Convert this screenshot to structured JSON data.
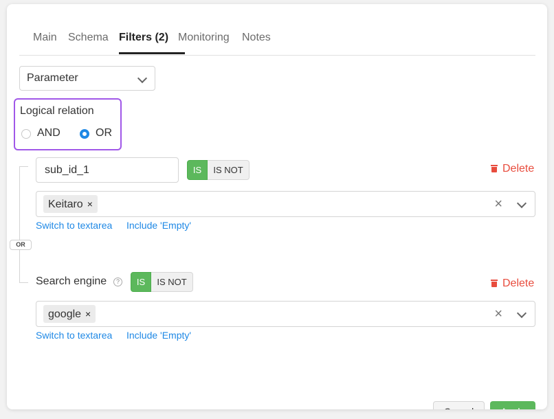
{
  "tabs": [
    {
      "label": "Main"
    },
    {
      "label": "Schema"
    },
    {
      "label": "Filters (2)"
    },
    {
      "label": "Monitoring"
    },
    {
      "label": "Notes"
    }
  ],
  "parameter_select": {
    "value": "Parameter",
    "icon": "chevron-down-icon"
  },
  "logical_relation": {
    "title": "Logical relation",
    "options": [
      {
        "label": "AND",
        "checked": false
      },
      {
        "label": "OR",
        "checked": true
      }
    ],
    "connector": "OR"
  },
  "filters": [
    {
      "field": "sub_id_1",
      "toggle": {
        "is": "IS",
        "is_not": "IS NOT",
        "selected": "IS"
      },
      "delete_label": "Delete",
      "chips": [
        "Keitaro"
      ],
      "chip_remove": "×",
      "clear_symbol": "×",
      "links": {
        "textarea": "Switch to textarea",
        "empty": "Include 'Empty'"
      }
    },
    {
      "field": "Search engine",
      "help_symbol": "?",
      "toggle": {
        "is": "IS",
        "is_not": "IS NOT",
        "selected": "IS"
      },
      "delete_label": "Delete",
      "chips": [
        "google"
      ],
      "chip_remove": "×",
      "clear_symbol": "×",
      "links": {
        "textarea": "Switch to textarea",
        "empty": "Include 'Empty'"
      }
    }
  ],
  "footer": {
    "cancel_label": "Cancel",
    "apply_label": "Apply"
  },
  "colors": {
    "accent_blue": "#1e88e5",
    "success_green": "#5cb85c",
    "danger_red": "#e84c3d",
    "highlight_purple": "#a057e8"
  }
}
